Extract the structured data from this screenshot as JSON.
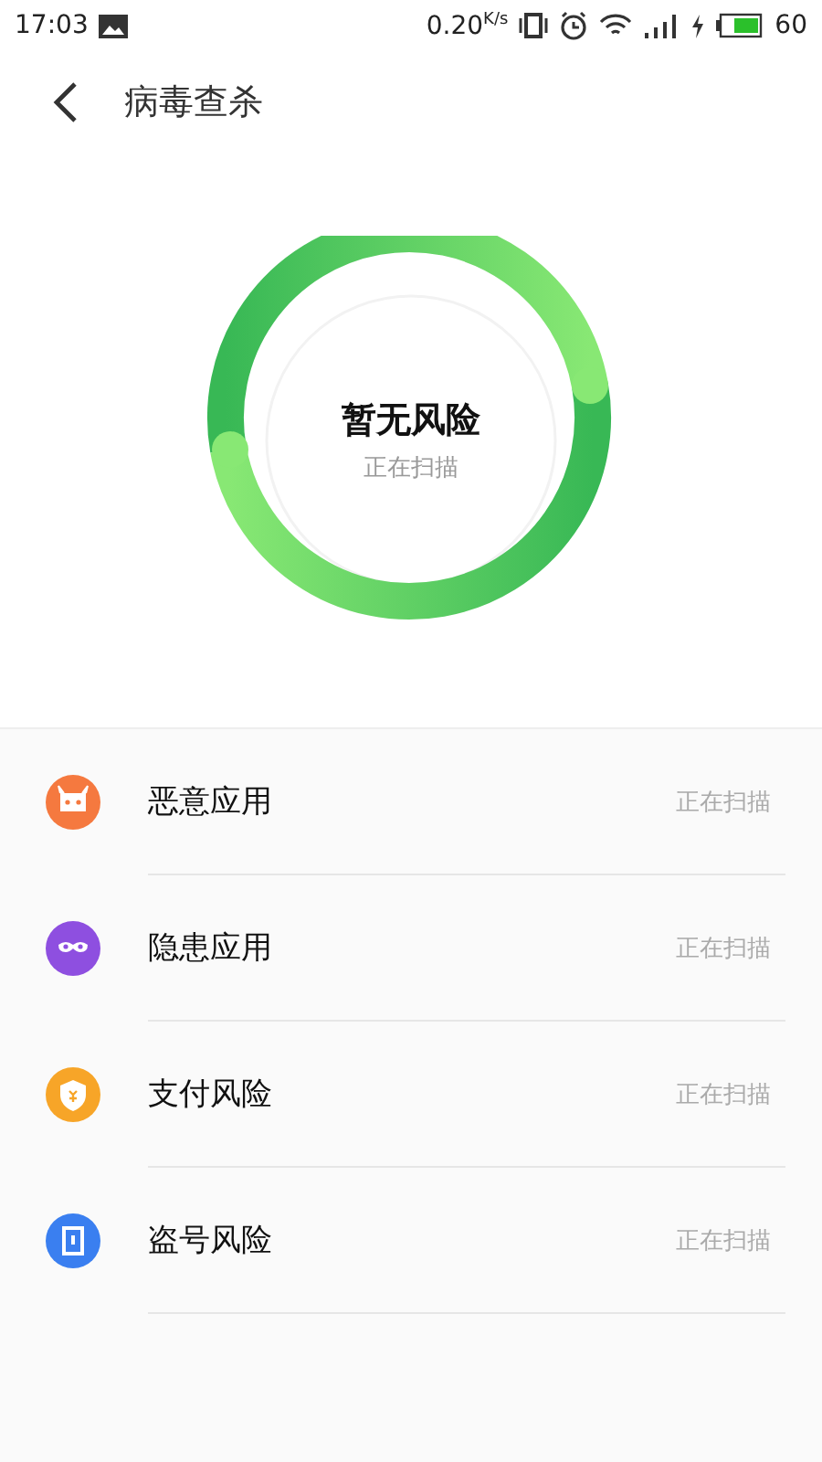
{
  "status_bar": {
    "time": "17:03",
    "speed": "0.20",
    "speed_unit": "K/s",
    "battery": "60"
  },
  "header": {
    "title": "病毒查杀"
  },
  "scan": {
    "status": "暂无风险",
    "progress": "正在扫描"
  },
  "items": [
    {
      "kind": "robot",
      "label": "恶意应用",
      "status": "正在扫描",
      "color": "#f5793f"
    },
    {
      "kind": "mask",
      "label": "隐患应用",
      "status": "正在扫描",
      "color": "#8e4fe0"
    },
    {
      "kind": "shield",
      "label": "支付风险",
      "status": "正在扫描",
      "color": "#f7a528"
    },
    {
      "kind": "phone",
      "label": "盗号风险",
      "status": "正在扫描",
      "color": "#3a7ff0"
    }
  ]
}
